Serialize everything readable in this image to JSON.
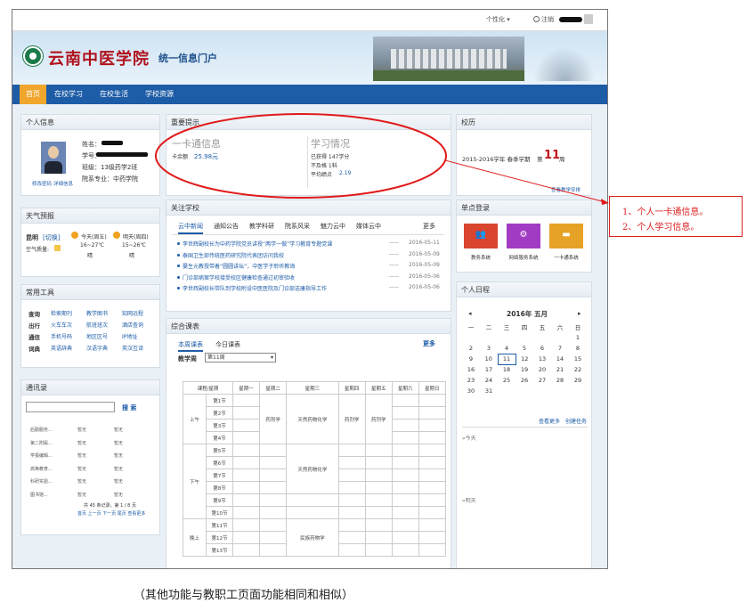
{
  "topbar": {
    "personalize": "个性化 ▾",
    "logout": "注销"
  },
  "banner": {
    "school_name": "云南中医学院",
    "portal_name": "统一信息门户"
  },
  "nav": {
    "items": [
      "首页",
      "在校学习",
      "在校生活",
      "学校资源"
    ]
  },
  "personal": {
    "title": "个人信息",
    "name_label": "姓名：",
    "id_label": "学号：",
    "class_label": "班级：13级药学2班",
    "dept_label": "院系专业：中药学院",
    "edit_link": "修改密码",
    "detail_link": "详细信息"
  },
  "weather": {
    "title": "天气预报",
    "city": "昆明",
    "switch": "[切换]",
    "air": "空气质量:",
    "today": {
      "label": "今天(周五)",
      "temp": "16~27℃",
      "desc": "晴"
    },
    "tomorrow": {
      "label": "明天(周四)",
      "temp": "15~26℃",
      "desc": "晴"
    }
  },
  "tools": {
    "title": "常用工具",
    "rows": [
      {
        "cat": "查询",
        "items": [
          "检索期刊",
          "教学图书",
          "知网远程"
        ]
      },
      {
        "cat": "出行",
        "items": [
          "火车车次",
          "航班班次",
          "酒店查询"
        ]
      },
      {
        "cat": "通信",
        "items": [
          "手机号码",
          "地区区号",
          "IP地址"
        ]
      },
      {
        "cat": "词典",
        "items": [
          "英语辞典",
          "汉语字典",
          "英汉互译"
        ]
      }
    ]
  },
  "contacts": {
    "title": "通讯录",
    "search": "搜 索",
    "rows": [
      [
        "后勤服务...",
        "暂无",
        "暂无"
      ],
      [
        "第二附属...",
        "暂无",
        "暂无"
      ],
      [
        "学报编辑...",
        "暂无",
        "暂无"
      ],
      [
        "高等教育...",
        "暂无",
        "暂无"
      ],
      [
        "科研实验...",
        "暂无",
        "暂无"
      ],
      [
        "图书馆...",
        "暂无",
        "暂无"
      ]
    ],
    "summary": "共 45 条记录，第 1 / 8 页",
    "pager": "首页 上一页 下一页 尾页 查看更多"
  },
  "notice": {
    "title": "重要提示",
    "card_title": "一卡通信息",
    "balance_label": "卡余额",
    "balance": "25.98元",
    "study_title": "学习情况",
    "earned": "已获得  147学分",
    "failed": "不及格  1科",
    "gpa_label": "平均绩点",
    "gpa": "2.19"
  },
  "news": {
    "title": "关注学校",
    "tabs": [
      "云中新闻",
      "通知公告",
      "教学科研",
      "院系风采",
      "魅力云中",
      "媒体云中"
    ],
    "more": "更多",
    "items": [
      {
        "text": "李世辉副校长为中药学院党员讲授“两学一做”学习教育专题党课",
        "date": "2016-05-11"
      },
      {
        "text": "泰国卫生部传统医药研究院代表团访问我校",
        "date": "2016-05-09"
      },
      {
        "text": "晏生元教授带着“圆圆讲坛”，中医学子聆听教诲",
        "date": "2016-05-09"
      },
      {
        "text": "门诊部病案学校接受校区健康检查通过初审验收",
        "date": "2016-05-06"
      },
      {
        "text": "李世辉副校长带队到学校附设中医医院及门诊部送康指导工作",
        "date": "2016-05-06"
      }
    ]
  },
  "schedule": {
    "title": "综合课表",
    "tabs": [
      "本周课表",
      "今日课表"
    ],
    "more": "更多",
    "week_label": "教学周",
    "week_value": "第11周",
    "header": [
      "课程/星期",
      "星期一",
      "星期二",
      "星期三",
      "星期四",
      "星期五",
      "星期六",
      "星期日"
    ],
    "periods": [
      "第1节",
      "第2节",
      "第3节",
      "第4节",
      "第5节",
      "第6节",
      "第7节",
      "第8节",
      "第9节",
      "第10节",
      "第11节",
      "第12节",
      "第13节"
    ],
    "sections": [
      "上午",
      "下午",
      "晚上"
    ],
    "courses": {
      "tue_morning": "药剂学",
      "wed_morning": "天然药物化学",
      "thu_morning": "药剂学",
      "fri_morning": "药剂学",
      "wed_afternoon": "天然药物化学",
      "wed_evening": "民族药物学"
    }
  },
  "calendar_box": {
    "title": "校历",
    "term": "2015-2016学年 春季学期",
    "week_prefix": "第",
    "week_num": "11",
    "week_suffix": "周",
    "link": "查看教学安排"
  },
  "sso": {
    "title": "单点登录",
    "apps": [
      {
        "label": "教务系统",
        "color": "#d9452f"
      },
      {
        "label": "网络服务系统",
        "color": "#a23bc4"
      },
      {
        "label": "一卡通系统",
        "color": "#e6a226"
      }
    ]
  },
  "agenda": {
    "title": "个人日程",
    "month": "2016年 五月",
    "prev": "◂",
    "next": "▸",
    "weekdays": [
      "一",
      "二",
      "三",
      "四",
      "五",
      "六",
      "日"
    ],
    "weeks": [
      [
        "",
        "",
        "",
        "",
        "",
        "",
        "1"
      ],
      [
        "2",
        "3",
        "4",
        "5",
        "6",
        "7",
        "8"
      ],
      [
        "9",
        "10",
        "11",
        "12",
        "13",
        "14",
        "15"
      ],
      [
        "16",
        "17",
        "18",
        "19",
        "20",
        "21",
        "22"
      ],
      [
        "23",
        "24",
        "25",
        "26",
        "27",
        "28",
        "29"
      ],
      [
        "30",
        "31",
        "",
        "",
        "",
        "",
        ""
      ]
    ],
    "today": "11",
    "view_more": "查看更多",
    "create": "创建任务",
    "today_label": "»今天",
    "tomorrow_label": "»明天"
  },
  "annotation": {
    "line1": "1、个人一卡通信息。",
    "line2": "2、个人学习信息。"
  },
  "caption": "（其他功能与教职工页面功能相同和相似）"
}
